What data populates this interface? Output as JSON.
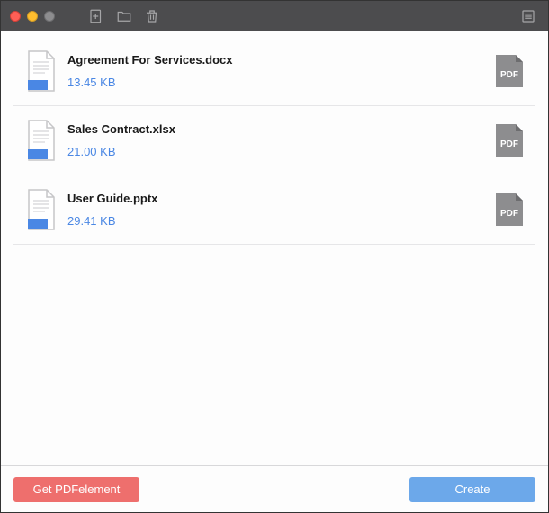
{
  "files": [
    {
      "name": "Agreement For Services.docx",
      "size": "13.45 KB"
    },
    {
      "name": "Sales Contract.xlsx",
      "size": "21.00 KB"
    },
    {
      "name": "User Guide.pptx",
      "size": "29.41 KB"
    }
  ],
  "pdf_badge_label": "PDF",
  "footer": {
    "get_label": "Get PDFelement",
    "create_label": "Create"
  },
  "colors": {
    "accent_blue": "#4a87e4",
    "btn_red": "#ee6f6d",
    "btn_blue": "#6ca8ea"
  }
}
